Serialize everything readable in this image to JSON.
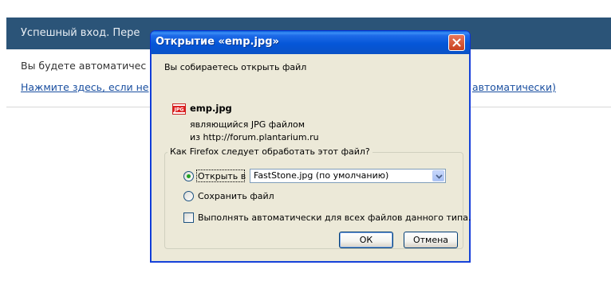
{
  "background_page": {
    "header_text": "Успешный вход. Пере",
    "auto_text": "Вы будете автоматичес",
    "link_text": "Нажмите здесь, если не",
    "link_tail": "автоматически)",
    "colors": {
      "header_bg": "#2b5478",
      "link": "#1a4fa0"
    }
  },
  "dialog": {
    "title": "Открытие «emp.jpg»",
    "intro": "Вы собираетесь открыть файл",
    "file": {
      "icon": "jpg-file-icon",
      "name": "emp.jpg",
      "type_line": "являющийся  JPG файлом",
      "source_line": "из  http://forum.plantarium.ru"
    },
    "group_label": "Как Firefox следует обработать этот файл?",
    "open_with": {
      "label": "Открыть в",
      "selected": true,
      "app": "FastStone.jpg (по умолчанию)"
    },
    "save_file": {
      "label": "Сохранить файл",
      "selected": false
    },
    "auto_checkbox": {
      "label": "Выполнять автоматически для всех файлов данного типа.",
      "checked": false
    },
    "buttons": {
      "ok": "ОК",
      "cancel": "Отмена"
    },
    "colors": {
      "titlebar": "#0556d8",
      "body": "#ece9d8",
      "close": "#c8401e"
    }
  }
}
